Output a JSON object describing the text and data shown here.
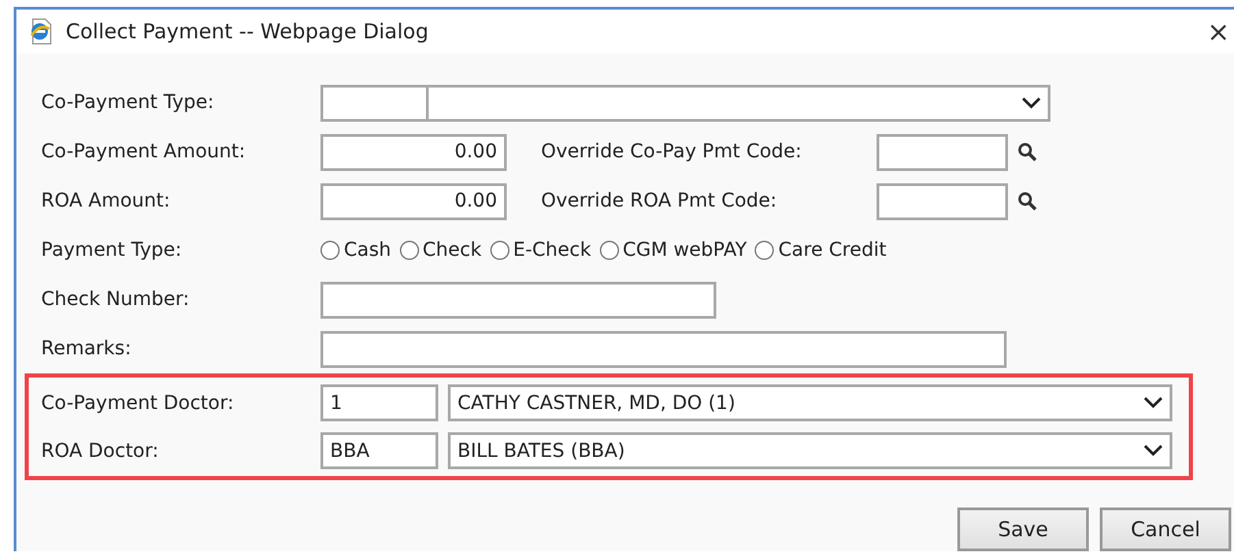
{
  "window": {
    "title": "Collect Payment -- Webpage Dialog",
    "close": "×"
  },
  "rows": [
    {
      "kind": "combo",
      "label": "Co-Payment Type:"
    },
    {
      "kind": "amount",
      "label": "Co-Payment Amount:",
      "value": "0.00",
      "override_label": "Override Co-Pay Pmt Code:"
    },
    {
      "kind": "amount",
      "label": "ROA Amount:",
      "value": "0.00",
      "override_label": "Override ROA Pmt Code:"
    },
    {
      "kind": "radio",
      "label": "Payment Type:",
      "options": [
        {
          "label": "Cash",
          "selected": false
        },
        {
          "label": "Check",
          "selected": false
        },
        {
          "label": "E-Check",
          "selected": false
        },
        {
          "label": "CGM webPAY",
          "selected": false
        },
        {
          "label": "Care Credit",
          "selected": false
        }
      ]
    },
    {
      "kind": "short_text",
      "label": "Check Number:"
    },
    {
      "kind": "long_text",
      "label": "Remarks:"
    }
  ],
  "highlighted_rows": [
    {
      "label": "Co-Payment Doctor:",
      "code": "1",
      "value": "CATHY CASTNER, MD, DO (1)"
    },
    {
      "label": "ROA Doctor:",
      "code": "BBA",
      "value": "BILL BATES (BBA)"
    }
  ],
  "buttons": [
    "Save",
    "Cancel"
  ]
}
